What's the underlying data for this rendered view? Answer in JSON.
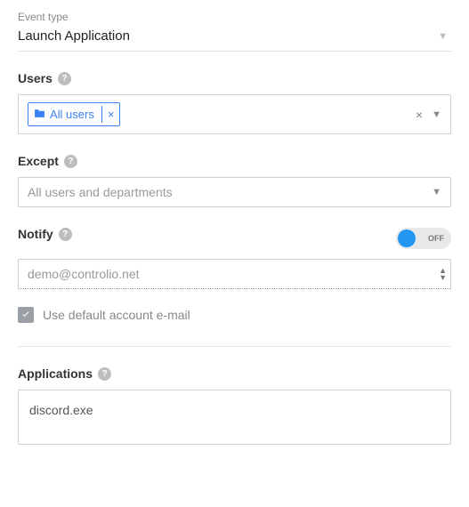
{
  "eventType": {
    "label": "Event type",
    "value": "Launch Application"
  },
  "users": {
    "label": "Users",
    "chip": {
      "text": "All users"
    }
  },
  "except": {
    "label": "Except",
    "placeholder": "All users and departments"
  },
  "notify": {
    "label": "Notify",
    "toggleState": "OFF",
    "email": "demo@controlio.net"
  },
  "defaultEmail": {
    "label": "Use default account e-mail",
    "checked": true
  },
  "applications": {
    "label": "Applications",
    "value": "discord.exe"
  }
}
